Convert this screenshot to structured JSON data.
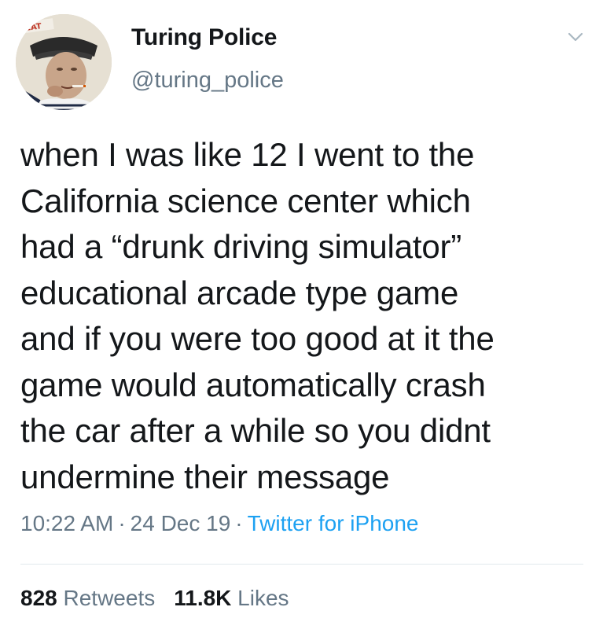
{
  "author": {
    "display_name": "Turing Police",
    "handle": "@turing_police",
    "avatar_badge_text": "EAT",
    "avatar_icon": "avatar-photo-elderly-sailor"
  },
  "tweet": {
    "text": "when I was like 12 I went to the\nCalifornia science center which\nhad a “drunk driving simulator”\neducational arcade type game\nand if you were too good at it the\ngame would automatically crash\nthe car after a while so you didnt\nundermine their message"
  },
  "meta": {
    "time": "10:22 AM",
    "separator": "·",
    "date": "24 Dec 19",
    "source": "Twitter for iPhone"
  },
  "stats": {
    "retweets_count": "828",
    "retweets_label": "Retweets",
    "likes_count": "11.8K",
    "likes_label": "Likes"
  },
  "colors": {
    "primary_text": "#14171a",
    "secondary_text": "#657786",
    "link": "#1da1f2",
    "divider": "#e1e8ed"
  },
  "icons": {
    "menu": "chevron-down-icon"
  }
}
